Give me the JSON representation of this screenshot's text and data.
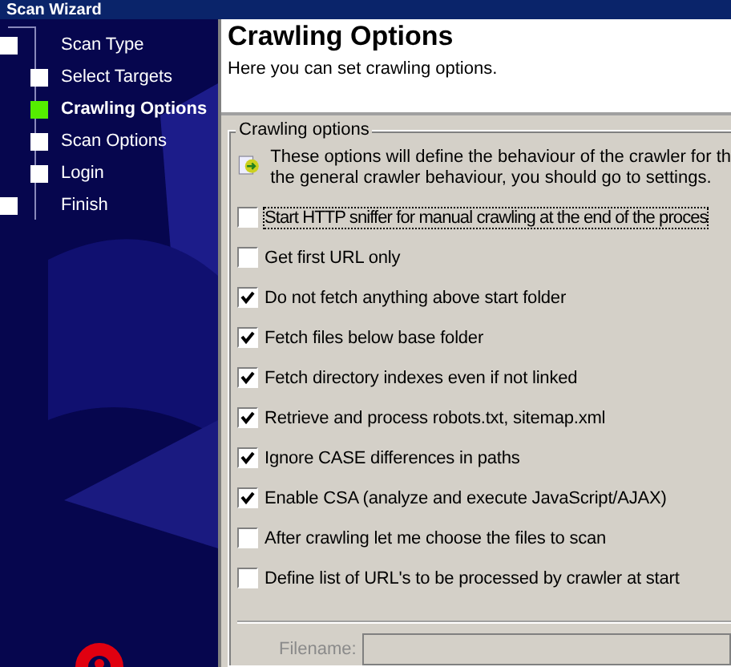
{
  "window": {
    "title": "Scan Wizard"
  },
  "steps": [
    {
      "label": "Scan Type",
      "kind": "outer",
      "selected": false
    },
    {
      "label": "Select Targets",
      "kind": "inner",
      "selected": false
    },
    {
      "label": "Crawling Options",
      "kind": "inner",
      "selected": true
    },
    {
      "label": "Scan Options",
      "kind": "inner",
      "selected": false
    },
    {
      "label": "Login",
      "kind": "inner",
      "selected": false
    },
    {
      "label": "Finish",
      "kind": "outer",
      "selected": false
    }
  ],
  "header": {
    "title": "Crawling Options",
    "subtitle": "Here you can set crawling options."
  },
  "group": {
    "title": "Crawling options",
    "info": [
      "These options will define the behaviour of the crawler for th",
      "the general crawler behaviour, you should go to settings."
    ]
  },
  "options": [
    {
      "label": "Start HTTP sniffer for manual crawling at the end of the proces",
      "checked": false,
      "focused": true
    },
    {
      "label": "Get first URL only",
      "checked": false,
      "focused": false
    },
    {
      "label": "Do not fetch anything above start folder",
      "checked": true,
      "focused": false
    },
    {
      "label": "Fetch files below base folder",
      "checked": true,
      "focused": false
    },
    {
      "label": "Fetch directory indexes even if not linked",
      "checked": true,
      "focused": false
    },
    {
      "label": "Retrieve and process robots.txt, sitemap.xml",
      "checked": true,
      "focused": false
    },
    {
      "label": "Ignore CASE differences in paths",
      "checked": true,
      "focused": false
    },
    {
      "label": "Enable CSA (analyze and execute JavaScript/AJAX)",
      "checked": true,
      "focused": false
    },
    {
      "label": "After crawling let me choose the files to scan",
      "checked": false,
      "focused": false
    },
    {
      "label": "Define list of URL's to be processed by crawler at start",
      "checked": false,
      "focused": false
    }
  ],
  "file": {
    "label": "Filename:",
    "disabled": true
  }
}
